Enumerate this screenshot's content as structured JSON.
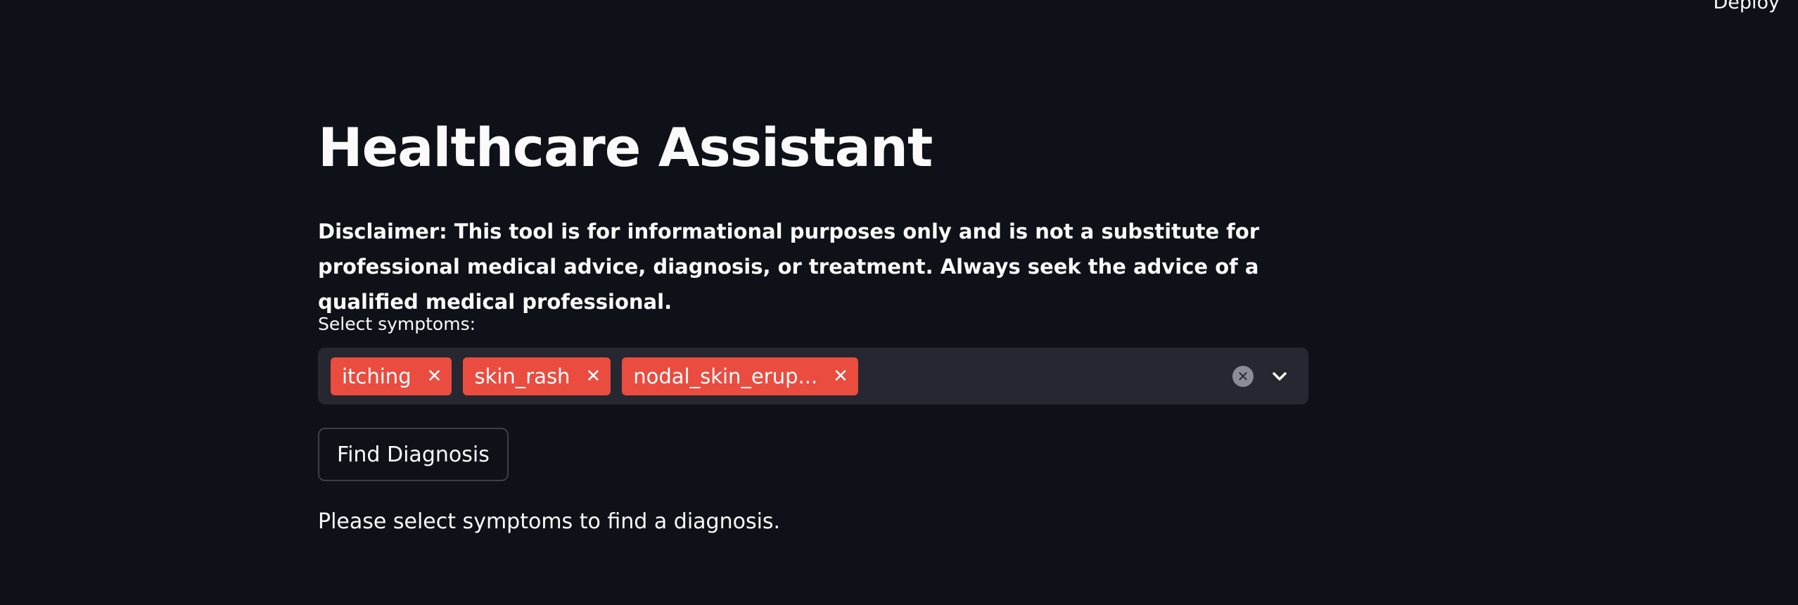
{
  "header": {
    "deploy_label": "Deploy"
  },
  "main": {
    "title": "Healthcare Assistant",
    "disclaimer": "Disclaimer: This tool is for informational purposes only and is not a substitute for professional medical advice, diagnosis, or treatment. Always seek the advice of a qualified medical professional.",
    "select_label": "Select symptoms:",
    "selected_symptoms": [
      "itching",
      "skin_rash",
      "nodal_skin_erup..."
    ],
    "find_button_label": "Find Diagnosis",
    "status_message": "Please select symptoms to find a diagnosis."
  },
  "icons": {
    "chip_remove": "close-icon",
    "clear_all": "clear-icon",
    "dropdown": "chevron-down-icon"
  },
  "colors": {
    "background": "#0e1117",
    "input_background": "#262730",
    "chip_accent": "#ea4c3f",
    "text": "#fafafa"
  }
}
